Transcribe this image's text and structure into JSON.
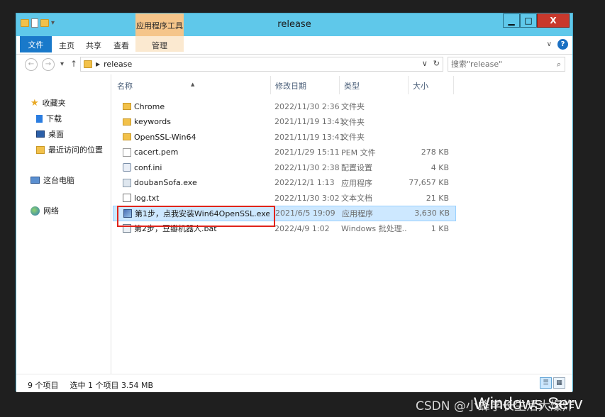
{
  "window": {
    "title": "release",
    "context_tab_group": "应用程序工具",
    "buttons": {
      "minimize": "▁",
      "maximize": "□",
      "close": "X"
    }
  },
  "menu": {
    "file": "文件",
    "tabs": [
      "主页",
      "共享",
      "查看"
    ],
    "context_tab": "管理",
    "help": "?",
    "expand": "∨"
  },
  "address": {
    "path": "release",
    "search_placeholder": "搜索\"release\"",
    "back": "←",
    "forward": "→",
    "up": "↑"
  },
  "nav": {
    "favorites": "收藏夹",
    "downloads": "下载",
    "desktop": "桌面",
    "recent": "最近访问的位置",
    "this_pc": "这台电脑",
    "network": "网络"
  },
  "columns": [
    "名称",
    "修改日期",
    "类型",
    "大小"
  ],
  "files": [
    {
      "name": "Chrome",
      "date": "2022/11/30 2:36",
      "type": "文件夹",
      "size": "",
      "icon": "folder"
    },
    {
      "name": "keywords",
      "date": "2021/11/19 13:41",
      "type": "文件夹",
      "size": "",
      "icon": "folder"
    },
    {
      "name": "OpenSSL-Win64",
      "date": "2021/11/19 13:41",
      "type": "文件夹",
      "size": "",
      "icon": "folder"
    },
    {
      "name": "cacert.pem",
      "date": "2021/1/29 15:11",
      "type": "PEM 文件",
      "size": "278 KB",
      "icon": "file"
    },
    {
      "name": "conf.ini",
      "date": "2022/11/30 2:38",
      "type": "配置设置",
      "size": "4 KB",
      "icon": "ini"
    },
    {
      "name": "doubanSofa.exe",
      "date": "2022/12/1 1:13",
      "type": "应用程序",
      "size": "77,657 KB",
      "icon": "exe"
    },
    {
      "name": "log.txt",
      "date": "2022/11/30 3:02",
      "type": "文本文档",
      "size": "21 KB",
      "icon": "txt"
    },
    {
      "name": "第1步，点我安装Win64OpenSSL.exe",
      "date": "2021/6/5 19:09",
      "type": "应用程序",
      "size": "3,630 KB",
      "icon": "setup",
      "selected": true
    },
    {
      "name": "第2步，豆瓣机器人.bat",
      "date": "2022/4/9 1:02",
      "type": "Windows 批处理...",
      "size": "1 KB",
      "icon": "bat"
    }
  ],
  "status": {
    "count": "9 个项目",
    "selection": "选中 1 个项目  3.54 MB"
  },
  "overlay": {
    "csdn": "CSDN @小蜂学长生活大爆炸",
    "brand": "Windows Serv"
  },
  "colors": {
    "titlebar": "#5fc8ea",
    "file_tab": "#1979ca",
    "context_tab": "#f5c58a",
    "selection": "#cde8ff",
    "highlight_box": "#e0241b",
    "close_button": "#c8382c"
  }
}
